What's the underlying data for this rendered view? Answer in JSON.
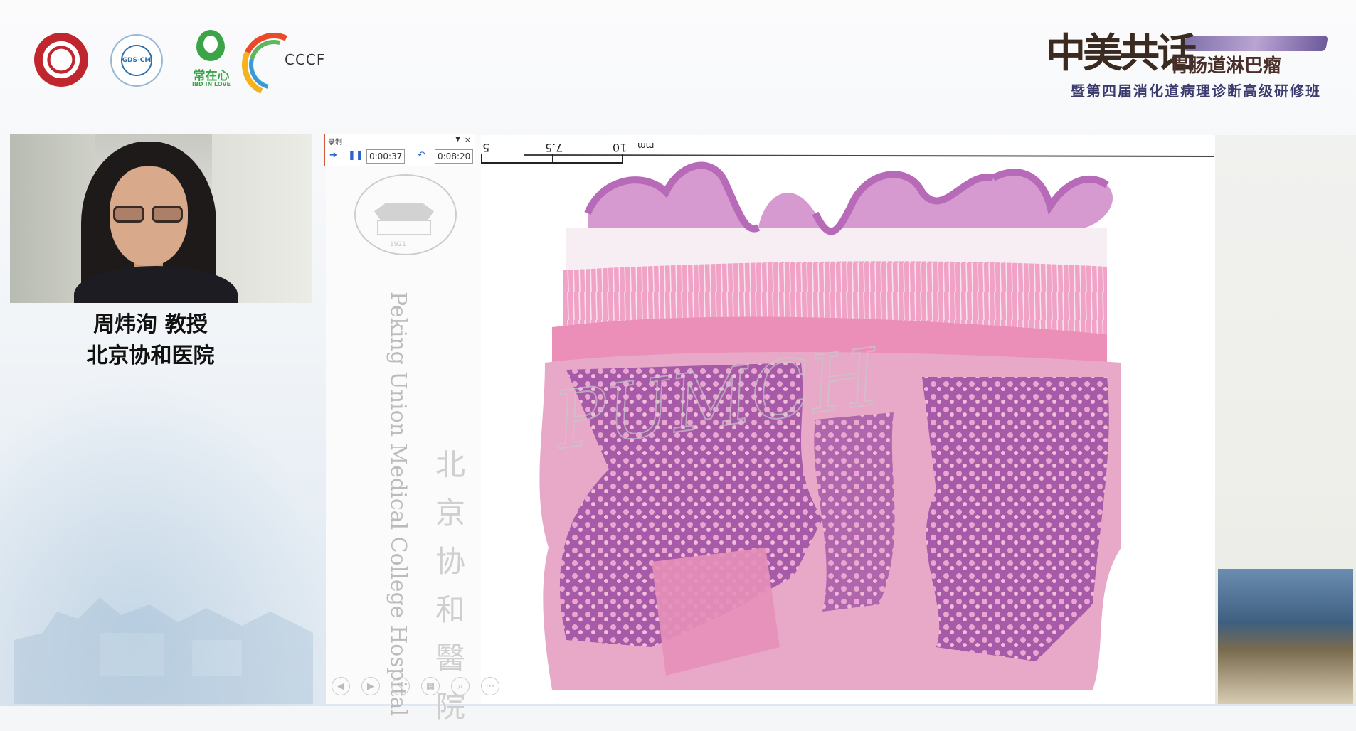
{
  "header": {
    "logos": [
      {
        "name": "hospital-emblem-logo"
      },
      {
        "name": "gds-cm-logo",
        "text": "GDS-CM"
      },
      {
        "name": "ibd-in-love-logo",
        "text_cn": "常在心",
        "text_en": "IBD IN LOVE"
      },
      {
        "name": "cccf-logo",
        "text": "CCCF"
      }
    ],
    "event_title_big": "中美共话",
    "event_title_main": "胃肠道淋巴瘤",
    "event_title_sub": "暨第四届消化道病理诊断高级研修班"
  },
  "speaker": {
    "name_line": "周炜洵 教授",
    "affiliation": "北京协和医院"
  },
  "recorder": {
    "label": "录制",
    "current_time": "0:00:37",
    "total_time": "0:08:20"
  },
  "slide": {
    "english_vertical": "Peking Union Medical College Hospital",
    "chinese_vertical": "北京协和醫院",
    "pumc_logo_year": "1921",
    "scale_labels": [
      "5",
      "7.5",
      "10",
      "mm"
    ]
  },
  "colors": {
    "recorder_border": "#d35a3a",
    "tissue_pink": "#e58fb8",
    "tissue_purple": "#8e4e9e"
  }
}
